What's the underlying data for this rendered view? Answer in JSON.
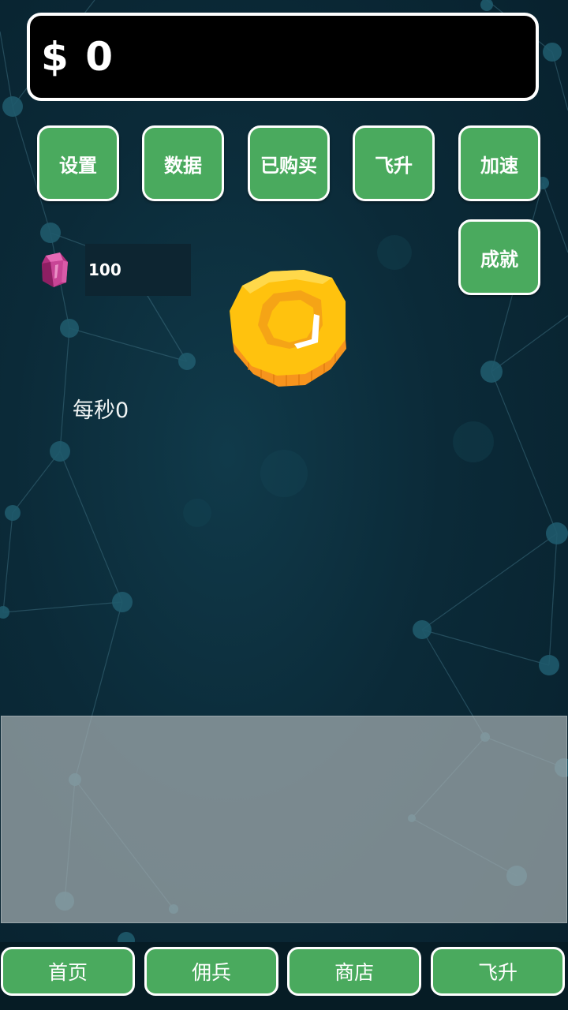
{
  "header": {
    "money": "$ 0"
  },
  "top_buttons": {
    "settings": "设置",
    "stats": "数据",
    "purchased": "已购买",
    "ascend": "飞升",
    "speedup": "加速",
    "achievements": "成就"
  },
  "gems": {
    "icon": "pink-gem-icon",
    "count": "100"
  },
  "clicker": {
    "icon": "gold-coin-icon",
    "per_second": "每秒0"
  },
  "bottom_nav": {
    "home": "首页",
    "mercenaries": "佣兵",
    "shop": "商店",
    "ascend": "飞升"
  },
  "colors": {
    "button_green": "#4aaa5e",
    "background_dark": "#0b2a38",
    "coin_gold": "#ffc20e",
    "gem_pink": "#c0398c"
  }
}
